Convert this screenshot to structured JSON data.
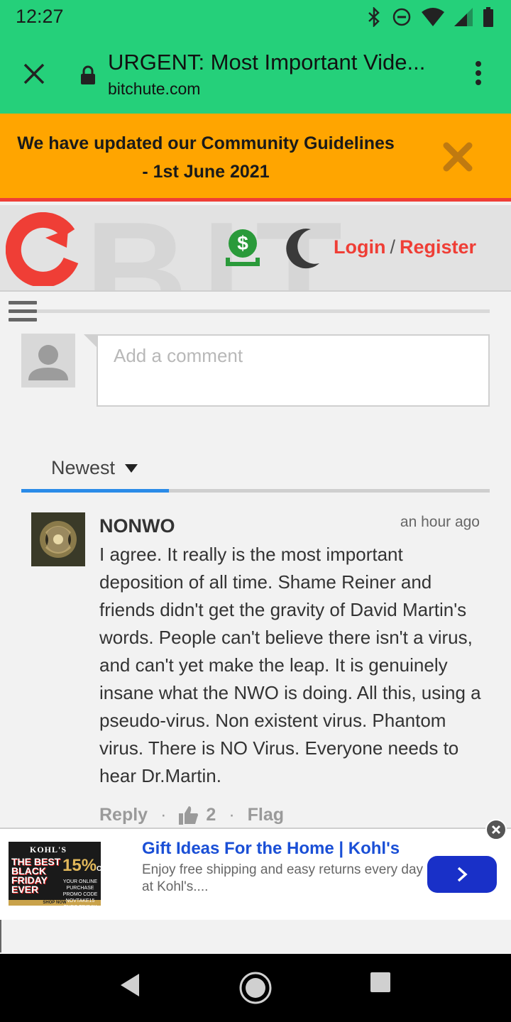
{
  "status_bar": {
    "time": "12:27"
  },
  "browser": {
    "title": "URGENT: Most Important Vide...",
    "host": "bitchute.com",
    "theme_color": "#25d07a"
  },
  "banner": {
    "line1": "We have updated our Community Guidelines",
    "line2": "- 1st June 2021",
    "color": "#ffa500"
  },
  "header": {
    "watermark": "BIT",
    "login_label": "Login",
    "separator": "/",
    "register_label": "Register",
    "accent_color": "#ef3e36"
  },
  "comment_form": {
    "placeholder": "Add a comment"
  },
  "sort": {
    "label": "Newest"
  },
  "comments": [
    {
      "author": "NONWO",
      "time": "an hour ago",
      "text": "I agree. It really is the most important deposition of all time. Shame Reiner and friends didn't get the gravity of David Martin's words. People can't believe there isn't a virus, and can't yet make the leap. It is genuinely insane what the NWO is doing. All this, using a pseudo-virus. Non existent virus. Phantom virus. There is NO Virus. Everyone needs to hear Dr.Martin.",
      "reply_label": "Reply",
      "likes": "2",
      "flag_label": "Flag",
      "dot": "·"
    }
  ],
  "ad": {
    "title": "Gift Ideas For the Home | Kohl's",
    "description": "Enjoy free shipping and easy returns every day at Kohl's....",
    "image": {
      "brand": "KOHL'S",
      "headline": "THE BEST BLACK FRIDAY EVER",
      "discount": "15%",
      "discount_suffix": "OFF",
      "promo": "YOUR ONLINE PURCHASE PROMO CODE NOVTAKE15 ENDS FRIDAY",
      "cta": "SHOP NOW"
    }
  }
}
